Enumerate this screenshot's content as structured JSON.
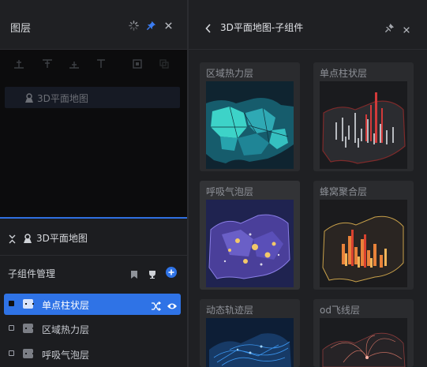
{
  "left_panel": {
    "title": "图层",
    "header_icons": [
      "loading-icon",
      "pin-icon",
      "close-icon"
    ],
    "align_tools": [
      "align-left-icon",
      "align-center-icon",
      "align-right-icon",
      "align-top-icon",
      "fit-icon",
      "copy-icon"
    ],
    "layer": {
      "label": "3D平面地图",
      "icon": "map-pin-icon"
    }
  },
  "subcomponent_section": {
    "parent_label": "3D平面地图",
    "manage_label": "子组件管理",
    "items": [
      {
        "label": "单点柱状层",
        "active": true
      },
      {
        "label": "区域热力层",
        "active": false
      },
      {
        "label": "呼吸气泡层",
        "active": false
      }
    ]
  },
  "right_panel": {
    "title": "3D平面地图-子组件",
    "cards": [
      {
        "title": "区域热力层",
        "selected": false
      },
      {
        "title": "单点柱状层",
        "selected": false
      },
      {
        "title": "呼吸气泡层",
        "selected": true
      },
      {
        "title": "蜂窝聚合层",
        "selected": false
      },
      {
        "title": "动态轨迹层",
        "selected": false
      },
      {
        "title": "od飞线层",
        "selected": false
      }
    ]
  },
  "colors": {
    "accent": "#2f73e6",
    "panel": "#1f2023",
    "canvas": "#0c0c0d"
  }
}
